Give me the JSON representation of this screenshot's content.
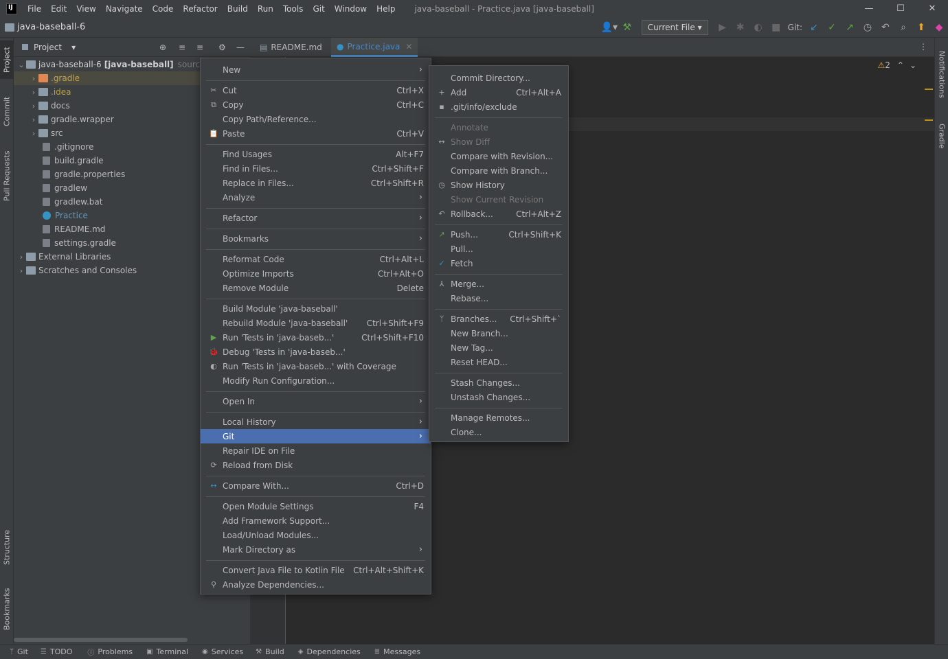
{
  "window": {
    "title": "java-baseball - Practice.java [java-baseball]",
    "menus": [
      "File",
      "Edit",
      "View",
      "Navigate",
      "Code",
      "Refactor",
      "Build",
      "Run",
      "Tools",
      "Git",
      "Window",
      "Help"
    ]
  },
  "nav": {
    "project_name": "java-baseball-6",
    "run_config": "Current File",
    "git_label": "Git:"
  },
  "project_panel": {
    "title": "Project",
    "root": "java-baseball-6",
    "root_bold": "[java-baseball]",
    "root_suffix": "sources ro",
    "items": [
      ".gradle",
      ".idea",
      "docs",
      "gradle.wrapper",
      "src",
      ".gitignore",
      "build.gradle",
      "gradle.properties",
      "gradlew",
      "gradlew.bat",
      "Practice",
      "README.md",
      "settings.gradle",
      "External Libraries",
      "Scratches and Consoles"
    ]
  },
  "tabs": [
    "README.md",
    "Practice.java"
  ],
  "editor": {
    "warnings": "2"
  },
  "left_tabs": [
    "Project",
    "Commit",
    "Pull Requests",
    "Structure",
    "Bookmarks"
  ],
  "right_tabs": [
    "Notifications",
    "Gradle"
  ],
  "context_menu": [
    {
      "label": "New",
      "submenu": true
    },
    {
      "label": "Cut",
      "shortcut": "Ctrl+X",
      "icon": "✂"
    },
    {
      "label": "Copy",
      "shortcut": "Ctrl+C",
      "icon": "⧉"
    },
    {
      "label": "Copy Path/Reference..."
    },
    {
      "label": "Paste",
      "shortcut": "Ctrl+V",
      "icon": "📋"
    },
    {
      "label": "Find Usages",
      "shortcut": "Alt+F7"
    },
    {
      "label": "Find in Files...",
      "shortcut": "Ctrl+Shift+F"
    },
    {
      "label": "Replace in Files...",
      "shortcut": "Ctrl+Shift+R"
    },
    {
      "label": "Analyze",
      "submenu": true
    },
    {
      "label": "Refactor",
      "submenu": true
    },
    {
      "label": "Bookmarks",
      "submenu": true
    },
    {
      "label": "Reformat Code",
      "shortcut": "Ctrl+Alt+L"
    },
    {
      "label": "Optimize Imports",
      "shortcut": "Ctrl+Alt+O"
    },
    {
      "label": "Remove Module",
      "shortcut": "Delete"
    },
    {
      "label": "Build Module 'java-baseball'"
    },
    {
      "label": "Rebuild Module 'java-baseball'",
      "shortcut": "Ctrl+Shift+F9"
    },
    {
      "label": "Run 'Tests in 'java-baseb...'",
      "shortcut": "Ctrl+Shift+F10",
      "icon": "▶"
    },
    {
      "label": "Debug 'Tests in 'java-baseb...'",
      "icon": "🐞"
    },
    {
      "label": "Run 'Tests in 'java-baseb...' with Coverage",
      "icon": "◐"
    },
    {
      "label": "Modify Run Configuration..."
    },
    {
      "label": "Open In",
      "submenu": true
    },
    {
      "label": "Local History",
      "submenu": true
    },
    {
      "label": "Git",
      "submenu": true
    },
    {
      "label": "Repair IDE on File"
    },
    {
      "label": "Reload from Disk",
      "icon": "⟳"
    },
    {
      "label": "Compare With...",
      "shortcut": "Ctrl+D",
      "icon": "↔"
    },
    {
      "label": "Open Module Settings",
      "shortcut": "F4"
    },
    {
      "label": "Add Framework Support..."
    },
    {
      "label": "Load/Unload Modules..."
    },
    {
      "label": "Mark Directory as",
      "submenu": true
    },
    {
      "label": "Convert Java File to Kotlin File",
      "shortcut": "Ctrl+Alt+Shift+K"
    },
    {
      "label": "Analyze Dependencies...",
      "icon": "⚲"
    }
  ],
  "git_menu": [
    {
      "label": "Commit Directory..."
    },
    {
      "label": "Add",
      "shortcut": "Ctrl+Alt+A",
      "icon": "+"
    },
    {
      "label": ".git/info/exclude",
      "icon": "▪"
    },
    {
      "label": "Annotate",
      "disabled": true
    },
    {
      "label": "Show Diff",
      "disabled": true,
      "icon": "↔"
    },
    {
      "label": "Compare with Revision..."
    },
    {
      "label": "Compare with Branch..."
    },
    {
      "label": "Show History",
      "icon": "◷"
    },
    {
      "label": "Show Current Revision",
      "disabled": true
    },
    {
      "label": "Rollback...",
      "shortcut": "Ctrl+Alt+Z",
      "icon": "↶"
    },
    {
      "label": "Push...",
      "shortcut": "Ctrl+Shift+K",
      "icon": "↗"
    },
    {
      "label": "Pull..."
    },
    {
      "label": "Fetch",
      "icon": "✓"
    },
    {
      "label": "Merge...",
      "icon": "⅄"
    },
    {
      "label": "Rebase..."
    },
    {
      "label": "Branches...",
      "shortcut": "Ctrl+Shift+`",
      "icon": "ᛘ"
    },
    {
      "label": "New Branch..."
    },
    {
      "label": "New Tag..."
    },
    {
      "label": "Reset HEAD..."
    },
    {
      "label": "Stash Changes..."
    },
    {
      "label": "Unstash Changes..."
    },
    {
      "label": "Manage Remotes..."
    },
    {
      "label": "Clone..."
    }
  ],
  "status_tabs": [
    "Git",
    "TODO",
    "Problems",
    "Terminal",
    "Services",
    "Build",
    "Dependencies",
    "Messages"
  ]
}
